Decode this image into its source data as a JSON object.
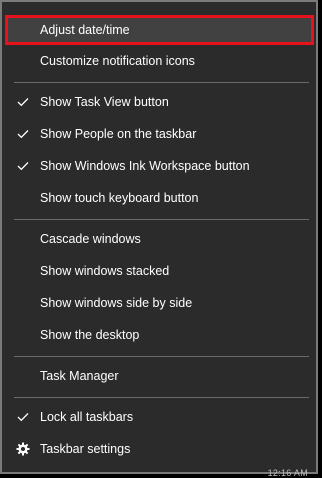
{
  "context_menu": {
    "items": [
      {
        "label": "Adjust date/time",
        "checked": false,
        "highlighted": true
      },
      {
        "label": "Customize notification icons",
        "checked": false
      },
      {
        "label": "Show Task View button",
        "checked": true
      },
      {
        "label": "Show People on the taskbar",
        "checked": true
      },
      {
        "label": "Show Windows Ink Workspace button",
        "checked": true
      },
      {
        "label": "Show touch keyboard button",
        "checked": false
      },
      {
        "label": "Cascade windows",
        "checked": false
      },
      {
        "label": "Show windows stacked",
        "checked": false
      },
      {
        "label": "Show windows side by side",
        "checked": false
      },
      {
        "label": "Show the desktop",
        "checked": false
      },
      {
        "label": "Task Manager",
        "checked": false
      },
      {
        "label": "Lock all taskbars",
        "checked": true
      },
      {
        "label": "Taskbar settings",
        "icon": "gear-icon"
      }
    ]
  },
  "taskbar_clock_partial": "12:16 AM",
  "colors": {
    "menu_background": "#2b2b2b",
    "highlight_outline": "#e8121c",
    "text": "#ffffff",
    "separator": "#6b6b6b"
  }
}
